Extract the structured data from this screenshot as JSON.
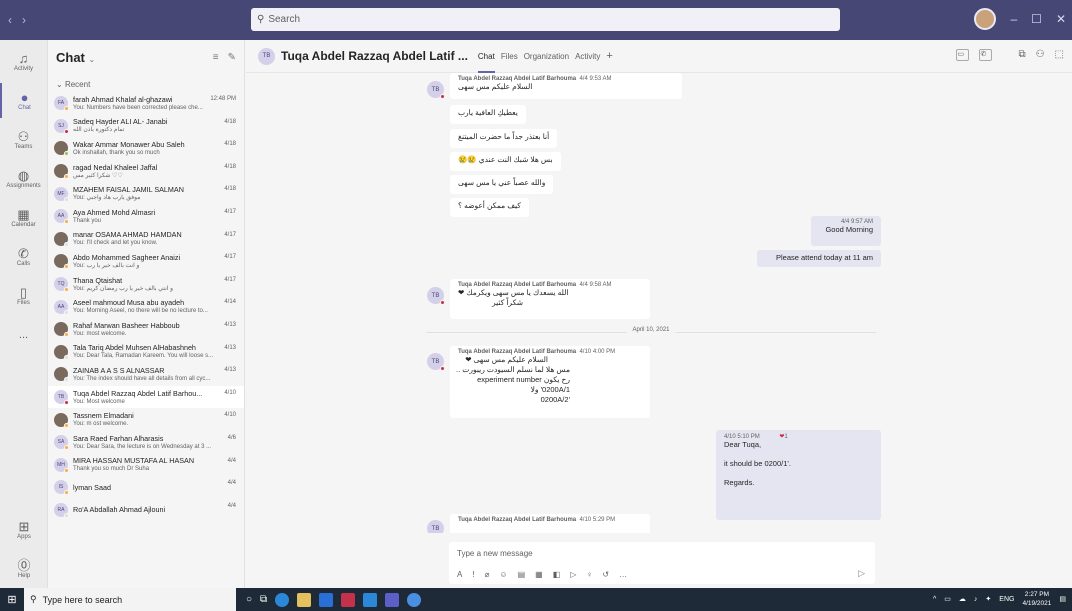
{
  "window": {
    "search_placeholder": "Search"
  },
  "rail": [
    {
      "label": "Activity",
      "icon": "bell-icon"
    },
    {
      "label": "Chat",
      "icon": "chat-icon",
      "active": true
    },
    {
      "label": "Teams",
      "icon": "teams-icon"
    },
    {
      "label": "Assignments",
      "icon": "assignments-icon"
    },
    {
      "label": "Calendar",
      "icon": "calendar-icon"
    },
    {
      "label": "Calls",
      "icon": "phone-icon"
    },
    {
      "label": "Files",
      "icon": "file-icon"
    }
  ],
  "rail_more": "...",
  "rail_bottom": [
    {
      "label": "Apps",
      "icon": "apps-icon"
    },
    {
      "label": "Help",
      "icon": "help-icon"
    }
  ],
  "list": {
    "title": "Chat",
    "recent_label": "Recent",
    "chats": [
      {
        "initials": "FA",
        "name": "farah Ahmad Khalaf al-ghazawi",
        "preview": "You: Numbers have been corrected please che...",
        "time": "12:48 PM",
        "status": "#ffaa44",
        "photo": false
      },
      {
        "initials": "SJ",
        "name": "Sadeq Hayder ALI AL- Janabi",
        "preview": "تمام دكتورة باذن الله",
        "time": "4/18",
        "status": "#c4314b",
        "photo": false
      },
      {
        "initials": "",
        "name": "Wakar Ammar Monawer Abu Saleh",
        "preview": "Ok inshallah, thank you so much",
        "time": "4/18",
        "status": "#92c353",
        "photo": true
      },
      {
        "initials": "",
        "name": "ragad Nedal Khaleel Jaffal",
        "preview": "شكراً كثير مس ♡♡",
        "time": "4/18",
        "status": "#ffaa44",
        "photo": true
      },
      {
        "initials": "MF",
        "name": "MZAHEM FAISAL JAMIL SALMAN",
        "preview": "You: موفق يارب هاد واجبي",
        "time": "4/18",
        "status": "#e0e0e0",
        "photo": false
      },
      {
        "initials": "AA",
        "name": "Aya Ahmed Mohd Almasri",
        "preview": "Thank you",
        "time": "4/17",
        "status": "#ffaa44",
        "photo": false
      },
      {
        "initials": "",
        "name": "manar OSAMA AHMAD HAMDAN",
        "preview": "You: I'll check and let you know.",
        "time": "4/17",
        "status": "#e0e0e0",
        "photo": true
      },
      {
        "initials": "",
        "name": "Abdo Mohammed Sagheer Anaizi",
        "preview": "You: و انت بالف خير يا رب",
        "time": "4/17",
        "status": "#ffaa44",
        "photo": true
      },
      {
        "initials": "TQ",
        "name": "Thana Qtaishat",
        "preview": "You: و انتي بالف خير يا رب رمضان كريم",
        "time": "4/17",
        "status": "#ffaa44",
        "photo": false
      },
      {
        "initials": "AA",
        "name": "Aseel mahmoud Musa abu ayadeh",
        "preview": "You: Morning Aseel, no there will be no lecture to...",
        "time": "4/14",
        "status": "#e0e0e0",
        "photo": false
      },
      {
        "initials": "",
        "name": "Rahaf Marwan Basheer Habboub",
        "preview": "You: most welcome.",
        "time": "4/13",
        "status": "#ffaa44",
        "photo": true
      },
      {
        "initials": "",
        "name": "Tala Tariq Abdel Muhsen AlHabashneh",
        "preview": "You: Dear Tala, Ramadan Kareem. You will loose s...",
        "time": "4/13",
        "status": "#e0e0e0",
        "photo": true
      },
      {
        "initials": "",
        "name": "ZAINAB A A S S ALNASSAR",
        "preview": "You: The index should have all details from all cyc...",
        "time": "4/13",
        "status": "#e0e0e0",
        "photo": true
      },
      {
        "initials": "TB",
        "name": "Tuqa Abdel Razzaq Abdel Latif Barhou...",
        "preview": "You: Most welcome",
        "time": "4/10",
        "status": "#c4314b",
        "photo": false,
        "selected": true
      },
      {
        "initials": "",
        "name": "Tassnem Elmadani",
        "preview": "You: m ost welcome.",
        "time": "4/10",
        "status": "#ffaa44",
        "photo": true
      },
      {
        "initials": "SA",
        "name": "Sara Raed Farhan Alharasis",
        "preview": "You: Dear Sara, the lecture is on Wednesday at 3 ...",
        "time": "4/6",
        "status": "#ffaa44",
        "photo": false
      },
      {
        "initials": "MH",
        "name": "MIRA HASSAN MUSTAFA AL HASAN",
        "preview": "Thank you so much Dr Suha",
        "time": "4/4",
        "status": "#ffaa44",
        "photo": false
      },
      {
        "initials": "IS",
        "name": "lyman Saad",
        "preview": "",
        "time": "4/4",
        "status": "#ffaa44",
        "photo": false
      },
      {
        "initials": "RA",
        "name": "Ro'A Abdallah Ahmad Ajlouni",
        "preview": "",
        "time": "4/4",
        "status": "#e0e0e0",
        "photo": false
      }
    ]
  },
  "header": {
    "initials": "TB",
    "name": "Tuqa Abdel Razzaq Abdel Latif ...",
    "tabs": [
      "Chat",
      "Files",
      "Organization",
      "Activity"
    ],
    "add": "+"
  },
  "messages": {
    "sender": "Tuqa Abdel Razzaq Abdel Latif Barhouma",
    "m1_time": "4/4 9:53 AM",
    "m1_lines": [
      "السلام عليكم مس سهى"
    ],
    "arabic_bubbles": [
      "يعطيكِ العافية يارب",
      "أنا بعتذر جداً ما حضرت الميتنغ",
      "بس هلا شبك النت عندي 😢😢",
      "والله عصباً عني يا مس سهى",
      "كيف ممكن أعوضه ؟"
    ],
    "me1_time": "4/4 9:57 AM",
    "me1_text": "Good Morning",
    "me2_text": "Please attend today at 11 am",
    "m2_time": "4/4 9:58 AM",
    "m2_lines": [
      "الله يسعدك يا مس سهى ويكرمك ❤",
      "شكراً كثير"
    ],
    "date_sep": "April 10, 2021",
    "m3_time": "4/10 4:00 PM",
    "m3_lines": [
      "السلام عليكم مس سهى ❤",
      "مس هلا لما نسلم السيودت ريبورت ..",
      "رح يكون experiment number",
      "0200A/1' ولا",
      "'0200A/2"
    ],
    "me3_time": "4/10 5:10 PM",
    "me3_reaction": "1",
    "me3_lines": [
      "Dear Tuqa,",
      "it should be 0200/1'.",
      "Regards."
    ],
    "m4_time": "4/10 5:29 PM"
  },
  "compose": {
    "placeholder": "Type a new message"
  },
  "taskbar": {
    "search_placeholder": "Type here to search",
    "lang": "ENG",
    "time": "2:27 PM",
    "date": "4/19/2021"
  }
}
